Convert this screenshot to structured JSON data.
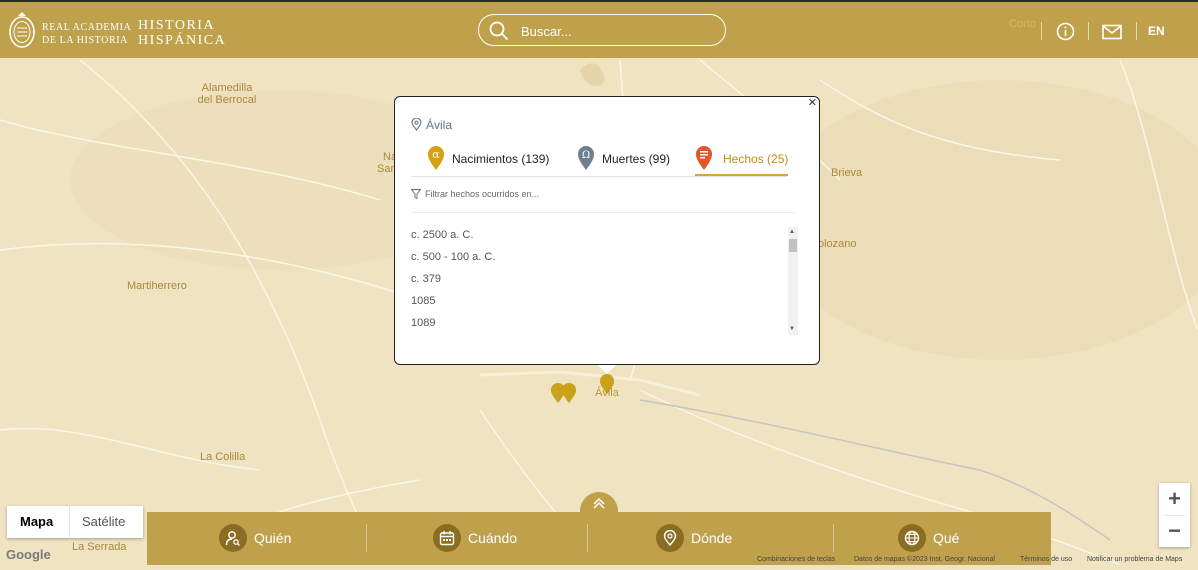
{
  "header": {
    "academy_line1": "REAL ACADEMIA",
    "academy_line2": "DE LA HISTORIA",
    "brand_line1": "HISTORIA",
    "brand_line2": "HISPÁNICA",
    "search_placeholder": "Buscar...",
    "corto": "Corto",
    "language": "EN"
  },
  "map": {
    "places": {
      "alamedilla": "Alamedilla\ndel Berrocal",
      "martiherrero": "Martiherrero",
      "la_colilla": "La Colilla",
      "la_serrada": "La Serrada",
      "brieva": "Brieva",
      "solozano": "olozano",
      "na": "Na",
      "san": "San"
    },
    "city_label": "Ávila"
  },
  "popup": {
    "location": "Ávila",
    "tabs": [
      {
        "label": "Nacimientos (139)",
        "icon": "alpha-pin-icon",
        "color": "#d4a20f"
      },
      {
        "label": "Muertes (99)",
        "icon": "omega-pin-icon",
        "color": "#6e7f90"
      },
      {
        "label": "Hechos (25)",
        "icon": "events-pin-icon",
        "color": "#e0582a"
      }
    ],
    "active_tab": "Hechos (25)",
    "filter_placeholder": "Filtrar hechos ocurridos en...",
    "items": [
      "c. 2500 a. C.",
      "c. 500 - 100 a. C.",
      "c. 379",
      "1085",
      "1089"
    ]
  },
  "bottom": {
    "map_types": [
      "Mapa",
      "Satélite"
    ],
    "nav": [
      "Quién",
      "Cuándo",
      "Dónde",
      "Qué"
    ]
  },
  "attribution": {
    "google": "Google",
    "shortcuts": "Combinaciones de teclas",
    "map_data": "Datos de mapas ©2023 Inst. Geogr. Nacional",
    "terms": "Términos de uso",
    "report": "Notificar un problema de Maps"
  },
  "colors": {
    "gold": "#bfa14c",
    "map_bg": "#efe3c2",
    "accent_orange": "#e0582a"
  }
}
